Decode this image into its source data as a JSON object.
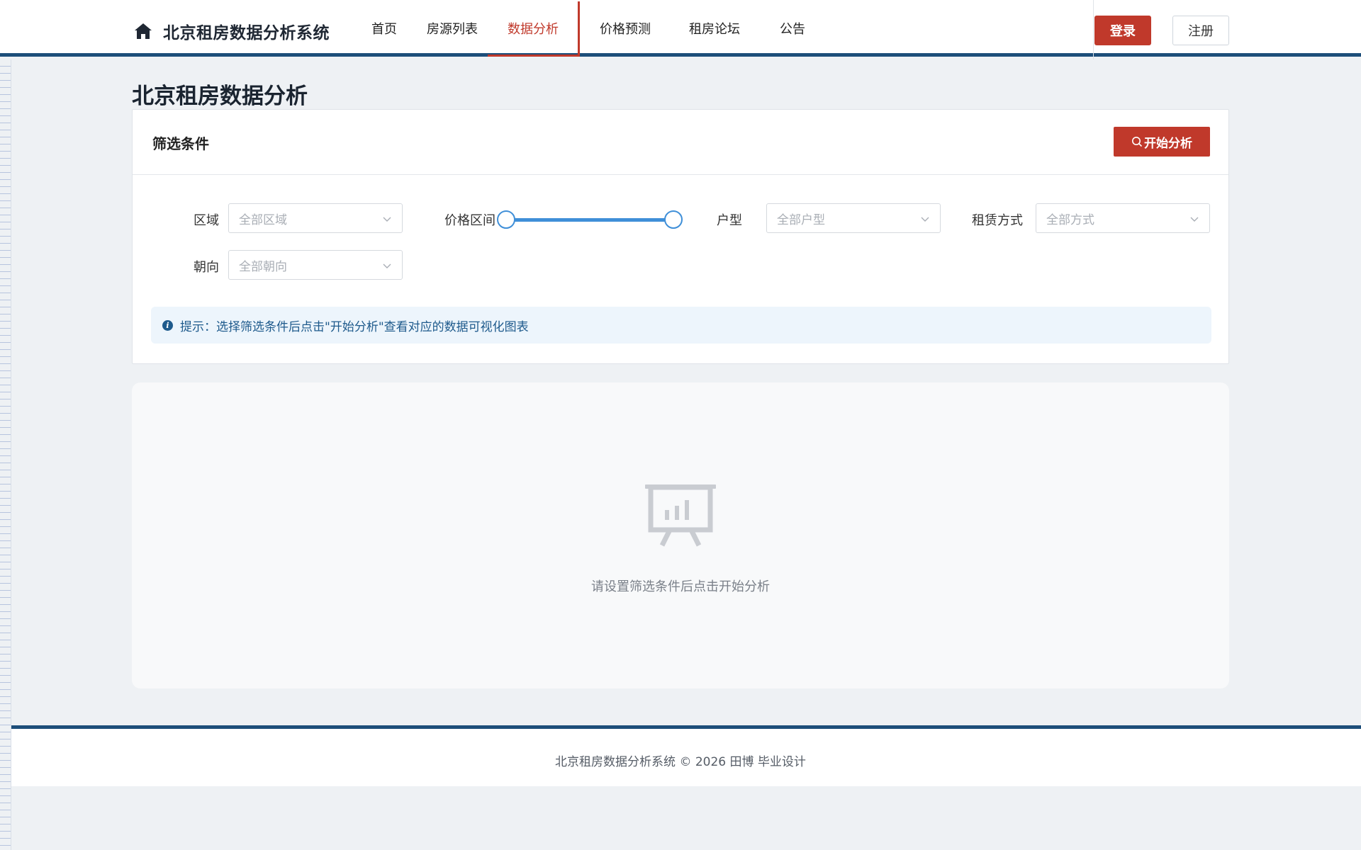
{
  "header": {
    "brand_title": "北京租房数据分析系统",
    "nav": [
      {
        "label": "首页",
        "active": false
      },
      {
        "label": "房源列表",
        "active": false
      },
      {
        "label": "数据分析",
        "active": true
      },
      {
        "label": "价格预测",
        "active": false
      },
      {
        "label": "租房论坛",
        "active": false
      },
      {
        "label": "公告",
        "active": false
      }
    ],
    "login_label": "登录",
    "register_label": "注册"
  },
  "page": {
    "title": "北京租房数据分析"
  },
  "filter": {
    "title": "筛选条件",
    "analyze_label": "开始分析",
    "district_label": "区域",
    "district_value": "全部区域",
    "price_label": "价格区间",
    "price_range_fraction": [
      0.0,
      1.0
    ],
    "layout_label": "户型",
    "layout_value": "全部户型",
    "rent_type_label": "租赁方式",
    "rent_type_value": "全部方式",
    "orientation_label": "朝向",
    "orientation_value": "全部朝向",
    "hint": "提示：选择筛选条件后点击\"开始分析\"查看对应的数据可视化图表"
  },
  "empty": {
    "text": "请设置筛选条件后点击开始分析"
  },
  "footer": {
    "text": "北京租房数据分析系统 © 2026 田博 毕业设计"
  },
  "colors": {
    "primary_red": "#c0392b",
    "navy": "#1d4e7a",
    "slider_blue": "#3f8fd8"
  }
}
